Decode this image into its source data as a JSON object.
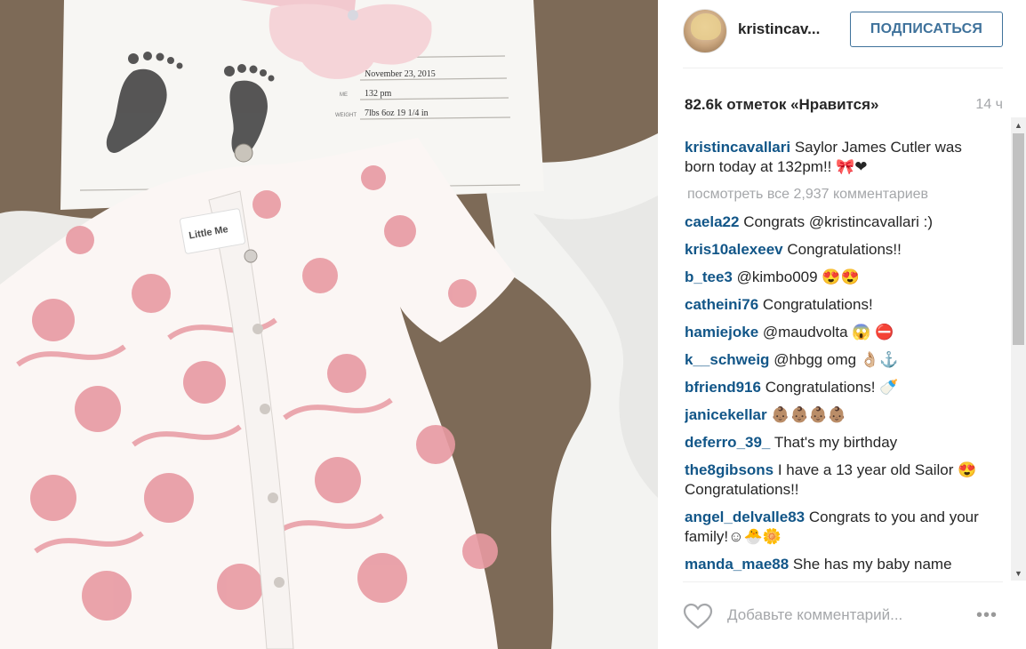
{
  "post": {
    "username": "kristincav...",
    "follow_label": "ПОДПИСАТЬСЯ",
    "likes": "82.6k отметок «Нравится»",
    "time": "14 ч",
    "caption_user": "kristincavallari",
    "caption_text": "Saylor James Cutler was born today at 132pm!! 🎀❤",
    "view_all": "посмотреть все 2,937 комментариев",
    "add_comment_placeholder": "Добавьте комментарий...",
    "more_label": "•••"
  },
  "photo": {
    "certificate_date": "November 23, 2015",
    "certificate_time": "132 pm",
    "certificate_weight": "7lbs 6oz   19 1/4 in",
    "certificate_time_label": "ME",
    "certificate_weight_label": "WEIGHT",
    "clothing_label": "Little Me"
  },
  "comments": [
    {
      "user": "caela22",
      "text": "Congrats @kristincavallari :)"
    },
    {
      "user": "kris10alexeev",
      "text": "Congratulations!!"
    },
    {
      "user": "b_tee3",
      "text": "@kimbo009 😍😍"
    },
    {
      "user": "catheini76",
      "text": "Congratulations!"
    },
    {
      "user": "hamiejoke",
      "text": "@maudvolta 😱 ⛔"
    },
    {
      "user": "k__schweig",
      "text": "@hbgg omg 👌🏼⚓"
    },
    {
      "user": "bfriend916",
      "text": "Congratulations! 🍼"
    },
    {
      "user": "janicekellar",
      "text": "👶🏽👶🏽👶🏽👶🏽"
    },
    {
      "user": "deferro_39_",
      "text": "That's my birthday"
    },
    {
      "user": "the8gibsons",
      "text": "I have a 13 year old Sailor 😍 Congratulations!!"
    },
    {
      "user": "angel_delvalle83",
      "text": "Congrats to you and your family!☺🐣🌼"
    },
    {
      "user": "manda_mae88",
      "text": "She has my baby name"
    }
  ]
}
